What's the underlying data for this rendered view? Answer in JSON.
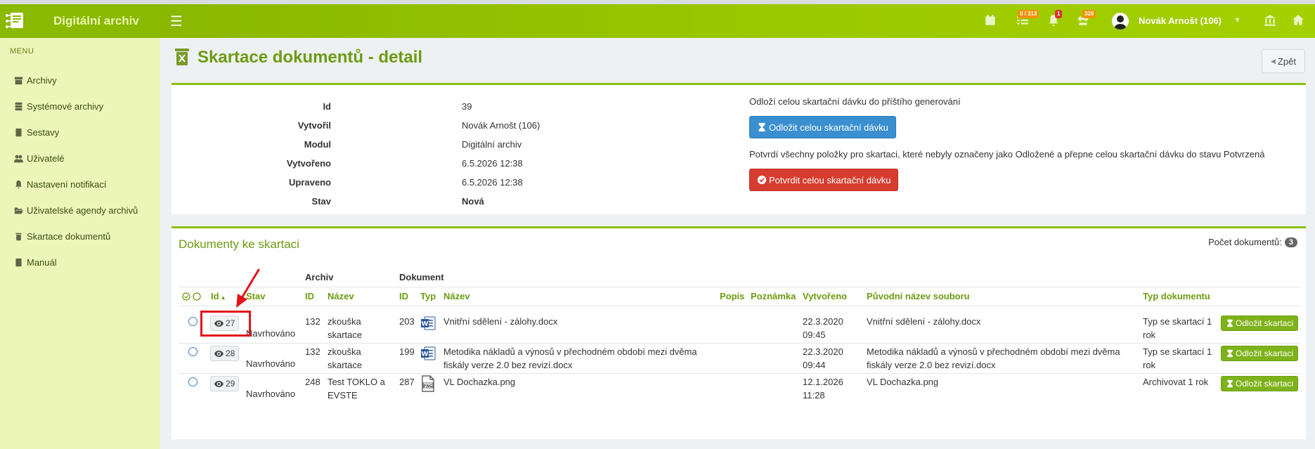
{
  "app": {
    "title": "Digitální archiv"
  },
  "navbar": {
    "tasks_badge": "0 / 313",
    "notifications_badge": "1",
    "mail_badge": "320",
    "user_name": "Novák Arnošt (106)"
  },
  "sidebar": {
    "header": "MENU",
    "items": [
      {
        "label": "Archivy",
        "icon": "archive-icon"
      },
      {
        "label": "Systémové archivy",
        "icon": "server-icon"
      },
      {
        "label": "Sestavy",
        "icon": "book-icon"
      },
      {
        "label": "Uživatelé",
        "icon": "users-icon"
      },
      {
        "label": "Nastavení notifikací",
        "icon": "bell-icon"
      },
      {
        "label": "Uživatelské agendy archivů",
        "icon": "folder-open-icon"
      },
      {
        "label": "Skartace dokumentů",
        "icon": "trash-icon"
      },
      {
        "label": "Manuál",
        "icon": "book-icon"
      }
    ]
  },
  "page": {
    "title": "Skartace dokumentů - detail",
    "back_label": "Zpět"
  },
  "detail": {
    "fields": [
      {
        "label": "Id",
        "value": "39",
        "bold": false
      },
      {
        "label": "Vytvořil",
        "value": "Novák Arnošt (106)",
        "bold": false
      },
      {
        "label": "Modul",
        "value": "Digitální archiv",
        "bold": false
      },
      {
        "label": "Vytvořeno",
        "value": "6.5.2026 12:38",
        "bold": false
      },
      {
        "label": "Upraveno",
        "value": "6.5.2026 12:38",
        "bold": false
      },
      {
        "label": "Stav",
        "value": "Nová",
        "bold": true
      }
    ],
    "defer_text": "Odloží celou skartační dávku do příštího generování",
    "defer_button": "Odložit celou skartační dávku",
    "confirm_text": "Potvrdí všechny položky pro skartaci, které nebyly označeny jako Odložené a přepne celou skartační dávku do stavu Potvrzená",
    "confirm_button": "Potvrdit celou skartační dávku"
  },
  "documents": {
    "title": "Dokumenty ke skartaci",
    "count_label": "Počet dokumentů:",
    "count": "3",
    "group_archive": "Archiv",
    "group_document": "Dokument",
    "headers": {
      "id": "Id",
      "stav": "Stav",
      "archive_id": "ID",
      "archive_name": "Název",
      "doc_id": "ID",
      "typ": "Typ",
      "doc_name": "Název",
      "popis": "Popis",
      "poznamka": "Poznámka",
      "vytvoreno": "Vytvořeno",
      "original_name": "Původní název souboru",
      "doc_type": "Typ dokumentu"
    },
    "defer_row_label": "Odložit skartaci",
    "rows": [
      {
        "id": "27",
        "stav": "Navrhováno",
        "archive_id": "132",
        "archive_name_1": "zkouška",
        "archive_name_2": "skartace",
        "doc_id": "203",
        "file_type": "word-icon",
        "doc_name_1": "Vnitřní sdělení - zálohy.docx",
        "doc_name_2": "",
        "created_1": "22.3.2020",
        "created_2": "09:45",
        "original_1": "Vnitřní sdělení - zálohy.docx",
        "original_2": "",
        "doc_type_1": "Typ se skartací 1",
        "doc_type_2": "rok"
      },
      {
        "id": "28",
        "stav": "Navrhováno",
        "archive_id": "132",
        "archive_name_1": "zkouška",
        "archive_name_2": "skartace",
        "doc_id": "199",
        "file_type": "word-icon",
        "doc_name_1": "Metodika nákladů a výnosů v přechodném období mezi dvěma",
        "doc_name_2": "fiskály verze 2.0 bez revizí.docx",
        "created_1": "22.3.2020",
        "created_2": "09:44",
        "original_1": "Metodika nákladů a výnosů v přechodném období mezi dvěma",
        "original_2": "fiskály verze 2.0 bez revizí.docx",
        "doc_type_1": "Typ se skartací 1",
        "doc_type_2": "rok"
      },
      {
        "id": "29",
        "stav": "Navrhováno",
        "archive_id": "248",
        "archive_name_1": "Test TOKLO a",
        "archive_name_2": "EVSTE",
        "doc_id": "287",
        "file_type": "png-icon",
        "doc_name_1": "VL Dochazka.png",
        "doc_name_2": "",
        "created_1": "12.1.2026",
        "created_2": "11:28",
        "original_1": "VL Dochazka.png",
        "original_2": "",
        "doc_type_1": "Archivovat 1 rok",
        "doc_type_2": ""
      }
    ]
  },
  "colors": {
    "brand_green": "#8cbf14",
    "title_green": "#6d9b12",
    "button_blue": "#3a8fd0",
    "button_red": "#d63c2f",
    "annotation_red": "#e0141b"
  }
}
